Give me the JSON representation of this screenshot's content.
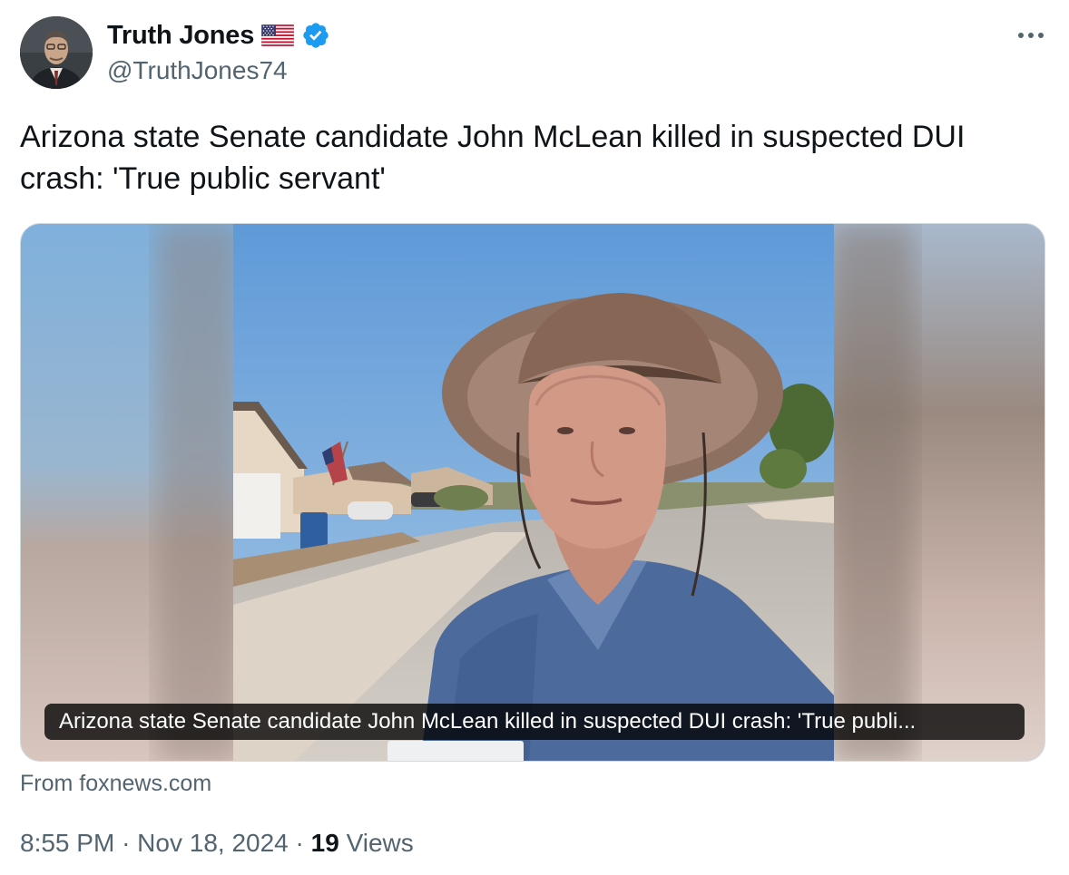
{
  "author": {
    "display_name": "Truth Jones",
    "handle": "@TruthJones74",
    "flag_icon": "us-flag-icon",
    "verified_icon": "verified-badge-icon",
    "verified_color": "#1d9bf0"
  },
  "more_icon": "more-dots-icon",
  "tweet": {
    "text": "Arizona state Senate candidate John McLean killed in suspected DUI crash: 'True public servant'"
  },
  "link_card": {
    "caption": "Arizona state Senate candidate John McLean killed in suspected DUI crash: 'True publi...",
    "source": "From foxnews.com"
  },
  "meta": {
    "time": "8:55 PM",
    "separator": "·",
    "date": "Nov 18, 2024",
    "views_count": "19",
    "views_label": "Views"
  },
  "colors": {
    "text_primary": "#0f1419",
    "text_secondary": "#536471",
    "border": "#cfd9de"
  }
}
